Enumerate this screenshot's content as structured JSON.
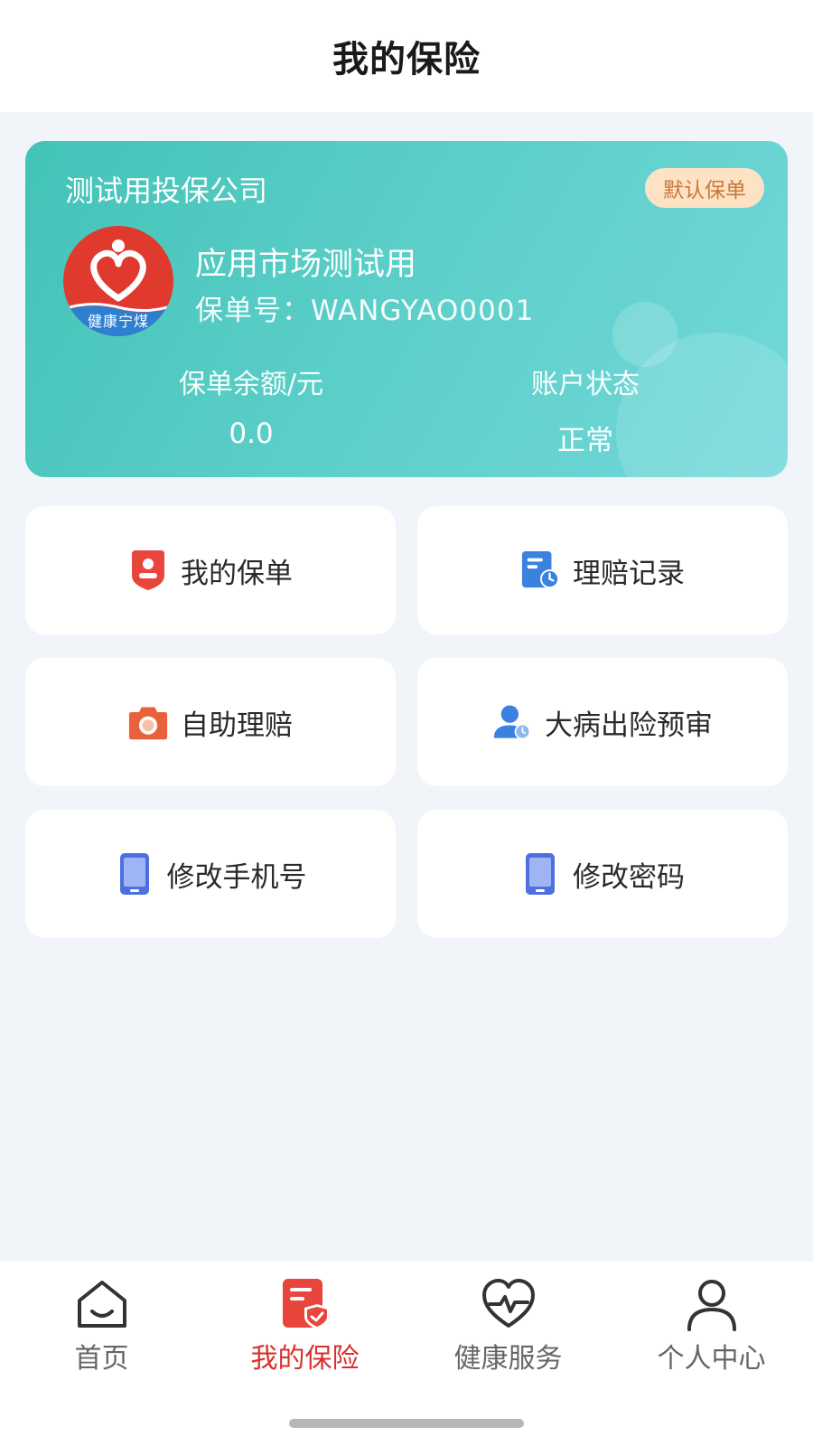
{
  "header": {
    "title": "我的保险"
  },
  "policy_card": {
    "company": "测试用投保公司",
    "badge": "默认保单",
    "logo_text": "健康宁煤",
    "product_name": "应用市场测试用",
    "policy_no_label": "保单号：",
    "policy_no": "WANGYAO0001",
    "balance_label": "保单余额/元",
    "balance_value": "0.0",
    "status_label": "账户状态",
    "status_value": "正常",
    "accent_color": "#43c3b7"
  },
  "menu": [
    {
      "label": "我的保单",
      "icon": "policy-shield-icon"
    },
    {
      "label": "理赔记录",
      "icon": "claim-record-icon"
    },
    {
      "label": "自助理赔",
      "icon": "camera-icon"
    },
    {
      "label": "大病出险预审",
      "icon": "user-clock-icon"
    },
    {
      "label": "修改手机号",
      "icon": "phone-icon"
    },
    {
      "label": "修改密码",
      "icon": "phone-icon"
    }
  ],
  "tabbar": {
    "active_color": "#d9302c",
    "tabs": [
      {
        "label": "首页",
        "icon": "home-icon"
      },
      {
        "label": "我的保险",
        "icon": "insurance-doc-icon",
        "active": true
      },
      {
        "label": "健康服务",
        "icon": "heart-pulse-icon"
      },
      {
        "label": "个人中心",
        "icon": "user-icon"
      }
    ]
  }
}
